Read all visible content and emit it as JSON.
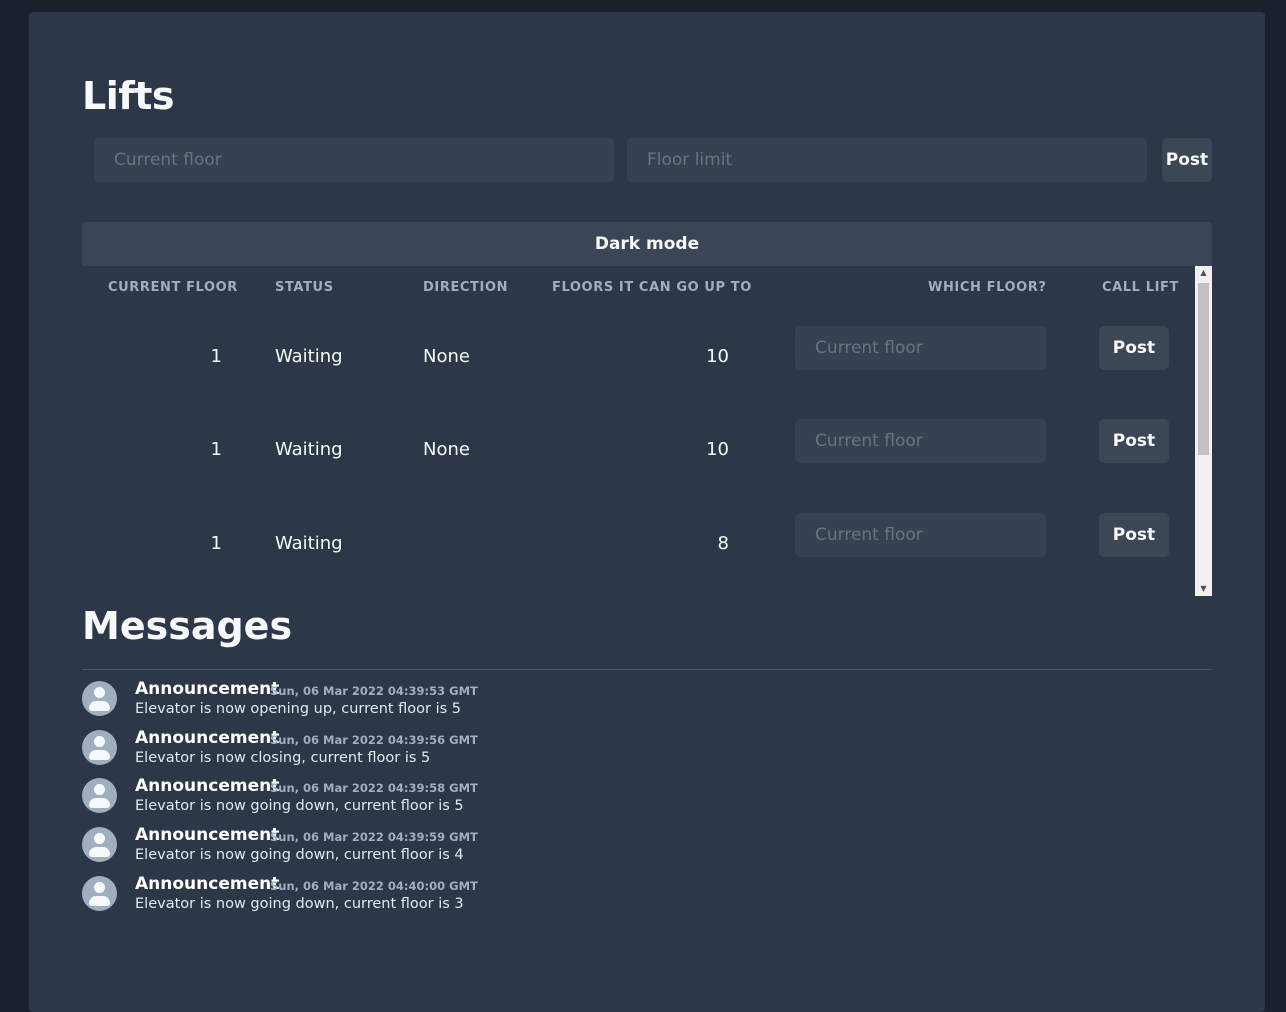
{
  "title": "Lifts",
  "form": {
    "current_floor_placeholder": "Current floor",
    "floor_limit_placeholder": "Floor limit",
    "post_label": "Post"
  },
  "dark_mode_label": "Dark mode",
  "table": {
    "headers": [
      "CURRENT FLOOR",
      "STATUS",
      "DIRECTION",
      "FLOORS IT CAN GO UP TO",
      "WHICH FLOOR?",
      "CALL LIFT"
    ],
    "input_placeholder": "Current floor",
    "post_label": "Post",
    "rows": [
      {
        "current_floor": "1",
        "status": "Waiting",
        "direction": "None",
        "limit": "10"
      },
      {
        "current_floor": "1",
        "status": "Waiting",
        "direction": "None",
        "limit": "10"
      },
      {
        "current_floor": "1",
        "status": "Waiting",
        "direction": "",
        "limit": "8"
      }
    ]
  },
  "messages": {
    "title": "Messages",
    "items": [
      {
        "author": "Announcement",
        "time": "Sun, 06 Mar 2022 04:39:53 GMT",
        "text": "Elevator is now opening up, current floor is 5"
      },
      {
        "author": "Announcement",
        "time": "Sun, 06 Mar 2022 04:39:56 GMT",
        "text": "Elevator is now closing, current floor is 5"
      },
      {
        "author": "Announcement",
        "time": "Sun, 06 Mar 2022 04:39:58 GMT",
        "text": "Elevator is now going down, current floor is 5"
      },
      {
        "author": "Announcement",
        "time": "Sun, 06 Mar 2022 04:39:59 GMT",
        "text": "Elevator is now going down, current floor is 4"
      },
      {
        "author": "Announcement",
        "time": "Sun, 06 Mar 2022 04:40:00 GMT",
        "text": "Elevator is now going down, current floor is 3"
      }
    ]
  }
}
